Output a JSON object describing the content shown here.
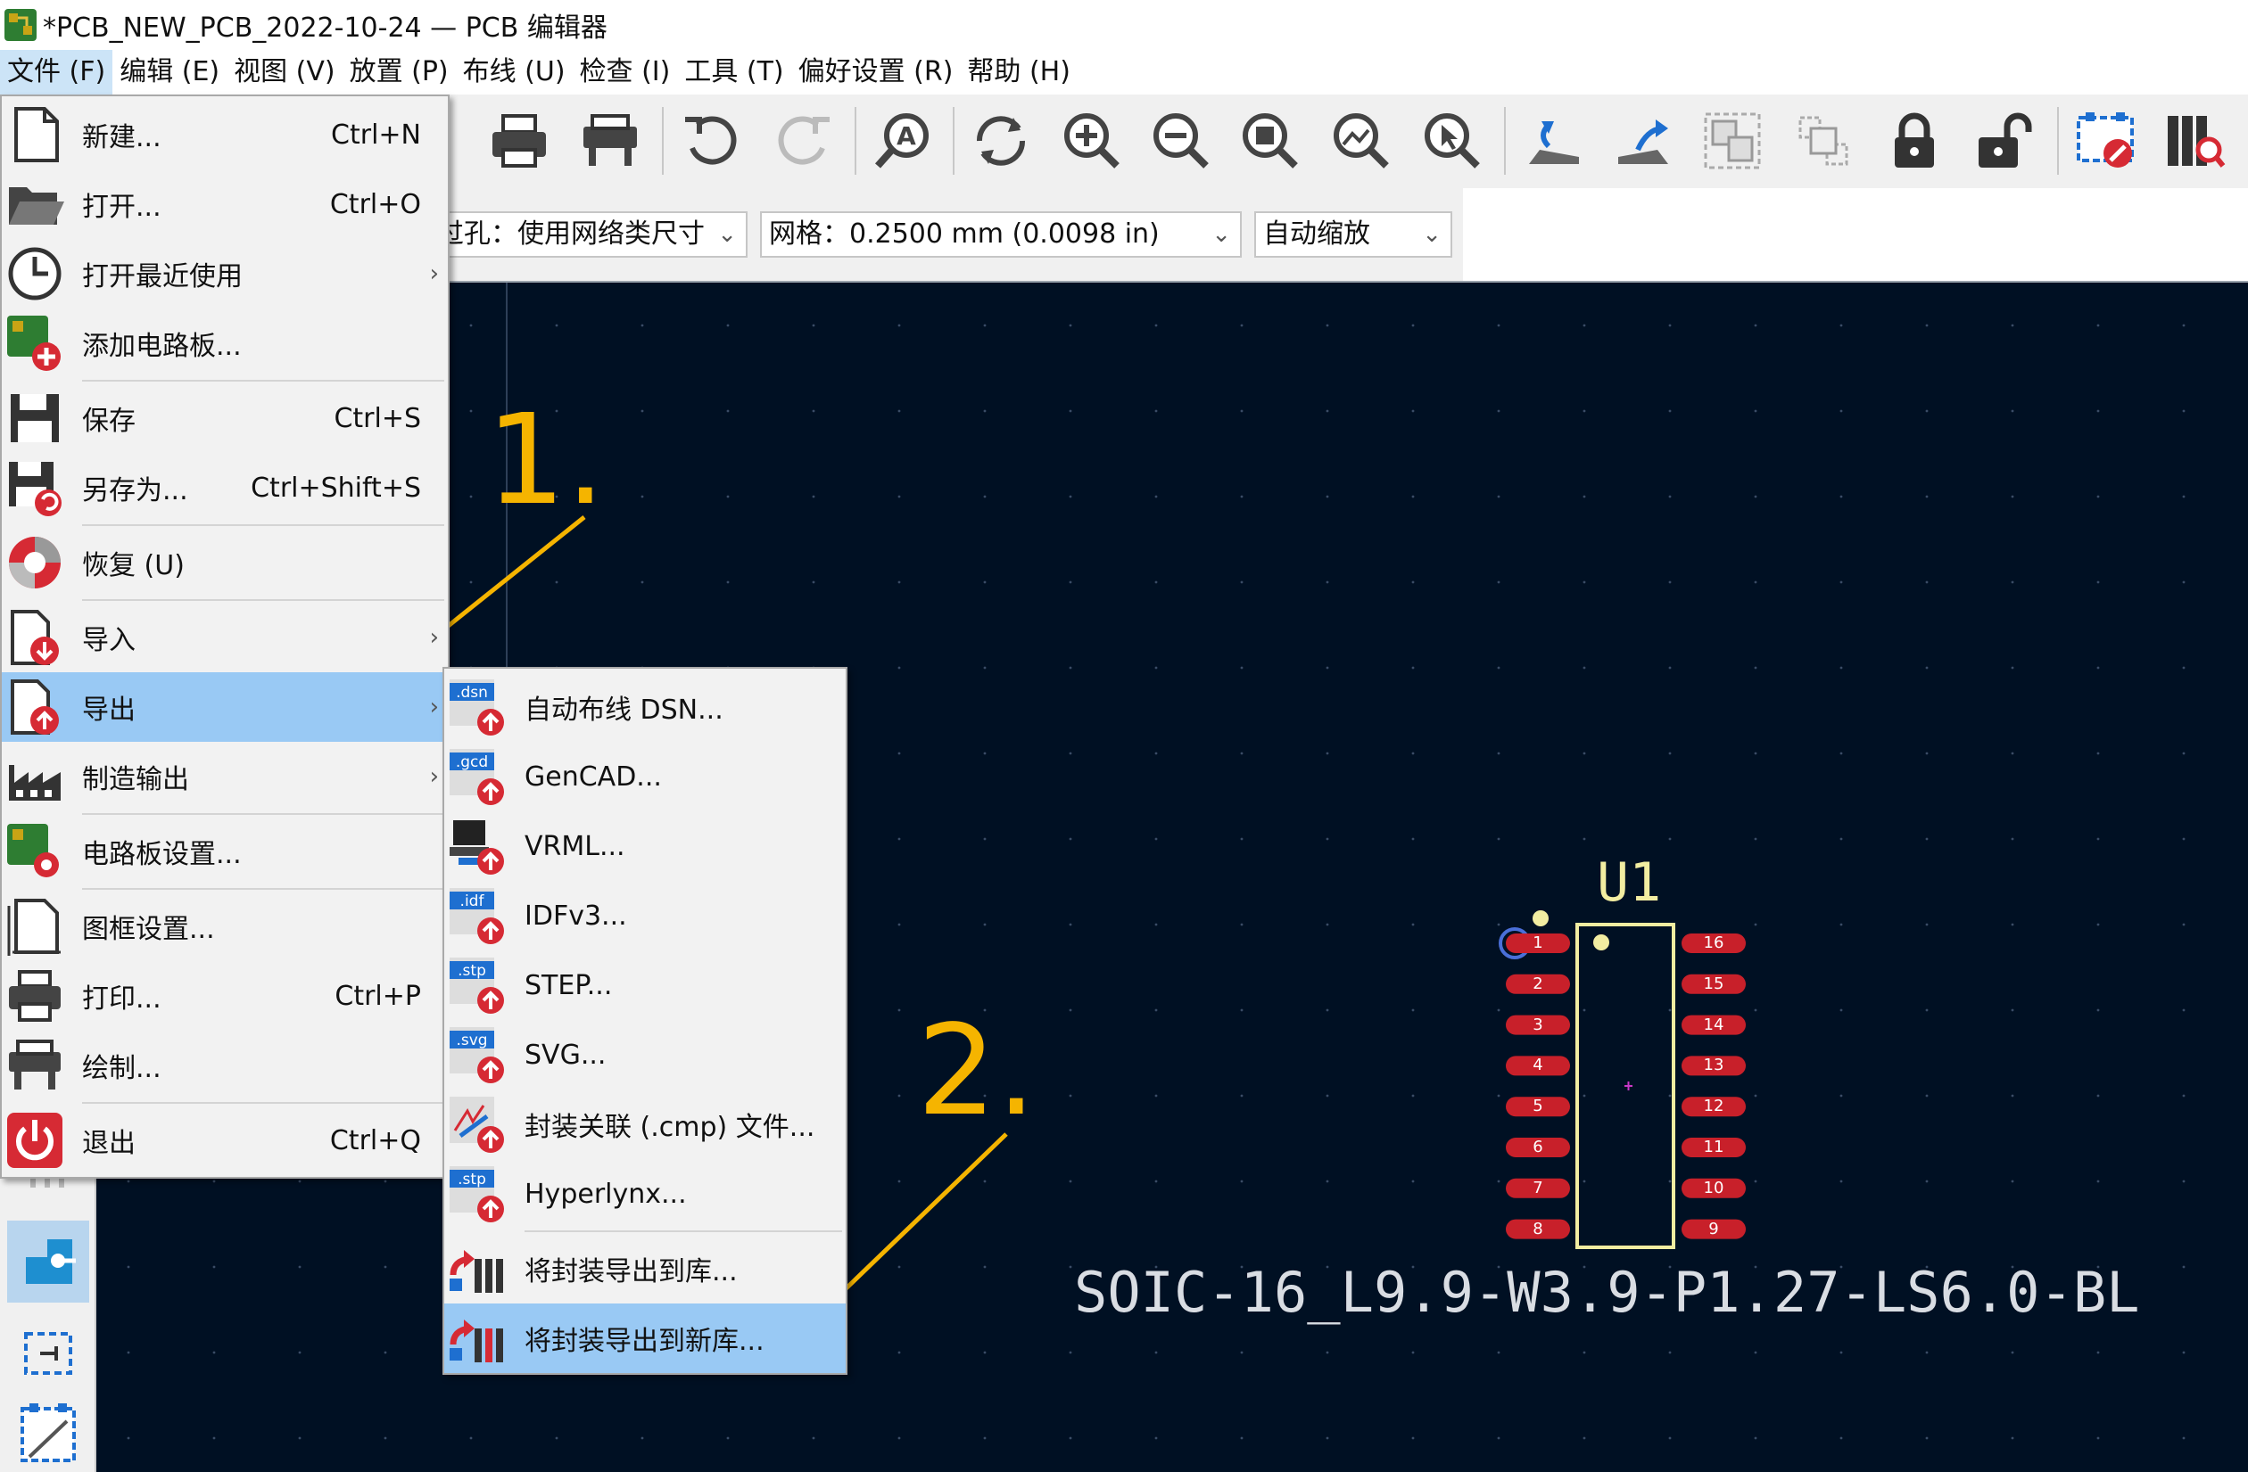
{
  "window": {
    "title": "*PCB_NEW_PCB_2022-10-24 — PCB 编辑器"
  },
  "menubar": [
    {
      "label": "文件 (F)",
      "active": true
    },
    {
      "label": "编辑 (E)"
    },
    {
      "label": "视图 (V)"
    },
    {
      "label": "放置 (P)"
    },
    {
      "label": "布线 (U)"
    },
    {
      "label": "检查 (I)"
    },
    {
      "label": "工具 (T)"
    },
    {
      "label": "偏好设置 (R)"
    },
    {
      "label": "帮助 (H)"
    }
  ],
  "toolbar2": {
    "via": "过孔：使用网络类尺寸",
    "grid": "网格：0.2500 mm (0.0098 in)",
    "zoom": "自动缩放"
  },
  "file_menu": [
    {
      "label": "新建...",
      "shortcut": "Ctrl+N"
    },
    {
      "label": "打开...",
      "shortcut": "Ctrl+O"
    },
    {
      "label": "打开最近使用",
      "arrow": "›"
    },
    {
      "label": "添加电路板..."
    },
    {
      "label": "保存",
      "shortcut": "Ctrl+S"
    },
    {
      "label": "另存为...",
      "shortcut": "Ctrl+Shift+S"
    },
    {
      "label": "恢复 (U)"
    },
    {
      "label": "导入",
      "arrow": "›"
    },
    {
      "label": "导出",
      "arrow": "›"
    },
    {
      "label": "制造输出",
      "arrow": "›"
    },
    {
      "label": "电路板设置..."
    },
    {
      "label": "图框设置..."
    },
    {
      "label": "打印...",
      "shortcut": "Ctrl+P"
    },
    {
      "label": "绘制..."
    },
    {
      "label": "退出",
      "shortcut": "Ctrl+Q"
    }
  ],
  "export_menu": [
    {
      "label": "自动布线 DSN...",
      "badge": ".dsn"
    },
    {
      "label": "GenCAD...",
      "badge": ".gcd"
    },
    {
      "label": "VRML..."
    },
    {
      "label": "IDFv3...",
      "badge": ".idf"
    },
    {
      "label": "STEP...",
      "badge": ".stp"
    },
    {
      "label": "SVG...",
      "badge": ".svg"
    },
    {
      "label": "封装关联 (.cmp) 文件..."
    },
    {
      "label": "Hyperlynx...",
      "badge": ".stp"
    },
    {
      "label": "将封装导出到库..."
    },
    {
      "label": "将封装导出到新库..."
    }
  ],
  "footprint": {
    "reference": "U1",
    "value": "SOIC-16_L9.9-W3.9-P1.27-LS6.0-BL",
    "left_pins": [
      "1",
      "2",
      "3",
      "4",
      "5",
      "6",
      "7",
      "8"
    ],
    "right_pins": [
      "16",
      "15",
      "14",
      "13",
      "12",
      "11",
      "10",
      "9"
    ]
  },
  "annotations": {
    "step1": "1.",
    "step2": "2."
  },
  "colors": {
    "canvas": "#001023",
    "pad": "#c8202a",
    "silk": "#f2eda1",
    "highlight": "#99c9f4",
    "arrow": "#f5b400"
  }
}
